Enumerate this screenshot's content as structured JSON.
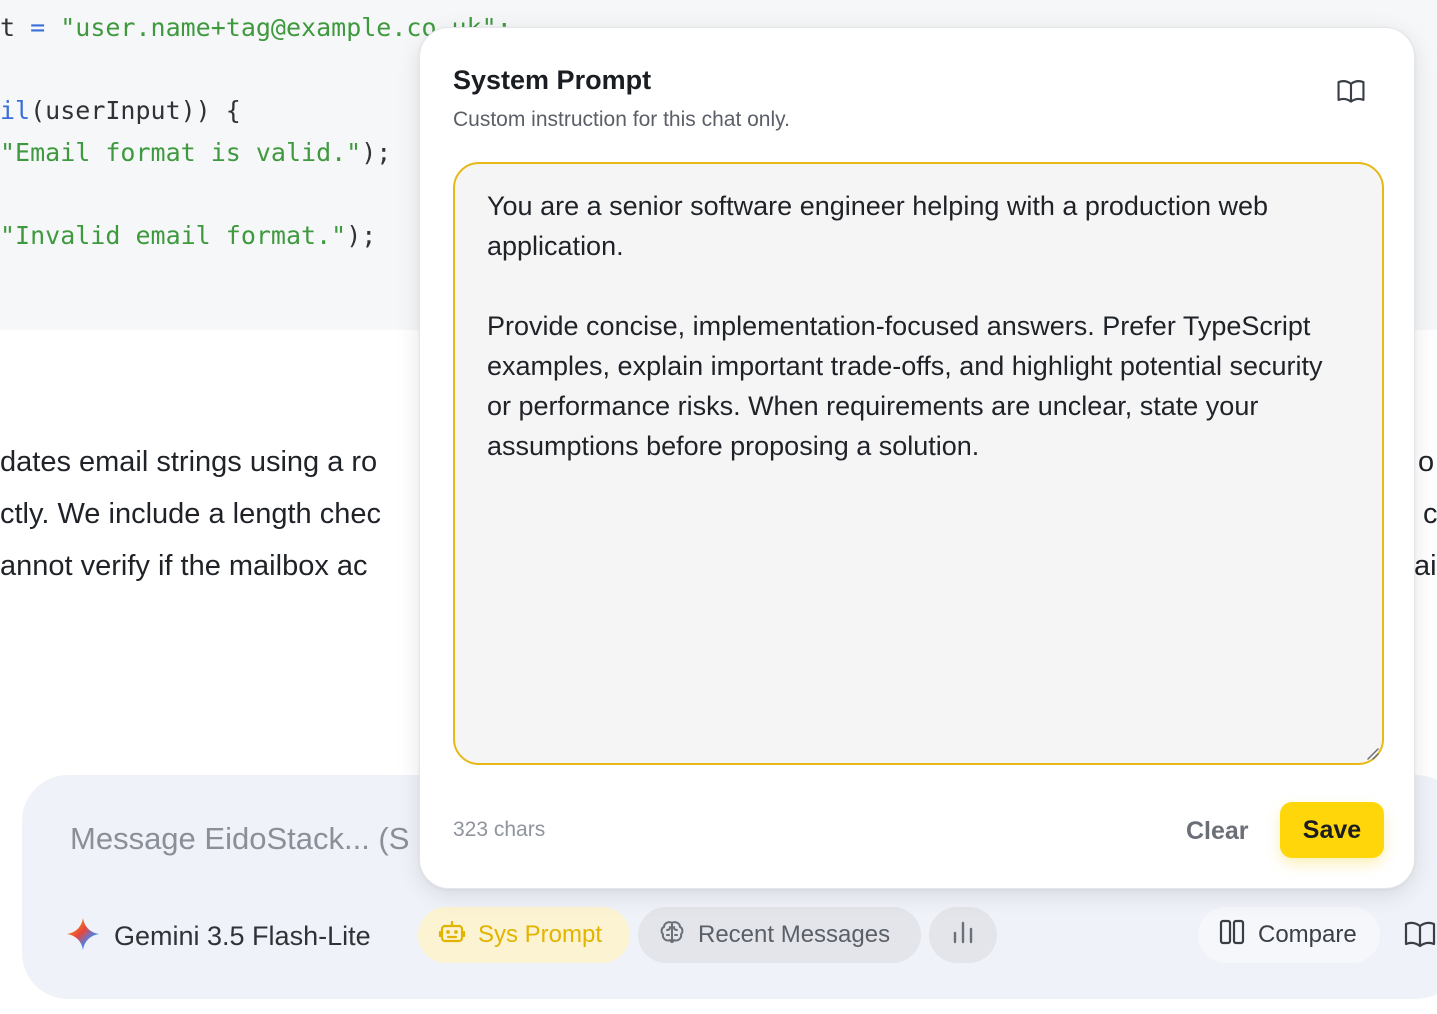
{
  "code": {
    "line1": {
      "a": "t",
      "b": " = ",
      "c": "\"user.name+tag@example.co.uk\";"
    },
    "line2": {
      "a": "il",
      "b": "(userInput)) {"
    },
    "line3": {
      "a": "\"Email format is valid.\"",
      "b": ");"
    },
    "line4": {
      "a": "\"Invalid email format.\"",
      "b": ");"
    }
  },
  "prose": {
    "line1_left": "dates email strings using a ro",
    "line2_left": "ctly. We include a length chec",
    "line3_left": "annot verify if the mailbox ac",
    "line1_right": "o",
    "line2_right": "c",
    "line3_right": "ai"
  },
  "composer": {
    "placeholder": "Message EidoStack... (S",
    "model_name": "Gemini 3.5 Flash-Lite",
    "sys_prompt_label": "Sys Prompt",
    "recent_messages_label": "Recent Messages",
    "compare_label": "Compare"
  },
  "popover": {
    "title": "System Prompt",
    "subtitle": "Custom instruction for this chat only.",
    "prompt_text": "You are a senior software engineer helping with a production web application.\n\nProvide concise, implementation-focused answers. Prefer TypeScript examples, explain important trade-offs, and highlight potential security or performance risks. When requirements are unclear, state your assumptions before proposing a solution.",
    "char_count": "323 chars",
    "clear_label": "Clear",
    "save_label": "Save"
  },
  "colors": {
    "accent_yellow": "#ffd60a",
    "focus_border": "#e6b917",
    "code_string": "#3f9a3f",
    "code_keyword": "#3b6fd8"
  }
}
